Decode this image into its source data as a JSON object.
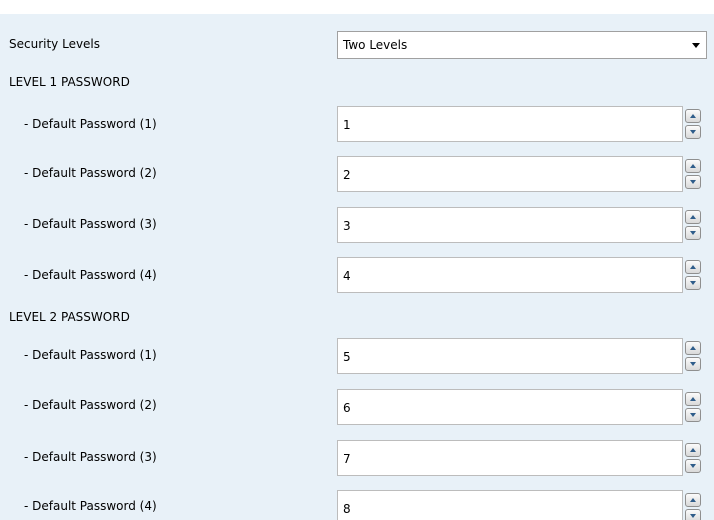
{
  "security_levels": {
    "label": "Security Levels",
    "selected": "Two Levels"
  },
  "level1": {
    "header": "LEVEL 1 PASSWORD",
    "fields": [
      {
        "label": "- Default Password (1)",
        "value": "1"
      },
      {
        "label": "- Default Password (2)",
        "value": "2"
      },
      {
        "label": "- Default Password (3)",
        "value": "3"
      },
      {
        "label": "- Default Password (4)",
        "value": "4"
      }
    ]
  },
  "level2": {
    "header": "LEVEL 2 PASSWORD",
    "fields": [
      {
        "label": "- Default Password (1)",
        "value": "5"
      },
      {
        "label": "- Default Password (2)",
        "value": "6"
      },
      {
        "label": "- Default Password (3)",
        "value": "7"
      },
      {
        "label": "- Default Password (4)",
        "value": "8"
      }
    ]
  },
  "icons": {
    "dropdown": "chevron-down-icon",
    "spin_up": "spin-up-icon",
    "spin_down": "spin-down-icon"
  },
  "colors": {
    "panel_background": "#e8f1f8",
    "field_background": "#ffffff",
    "spinner_arrow": "#2f5d8a"
  }
}
